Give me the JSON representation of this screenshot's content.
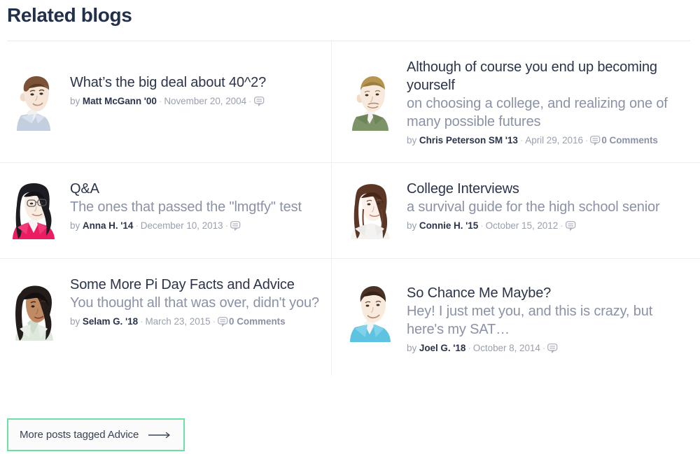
{
  "header": {
    "title": "Related blogs"
  },
  "posts": [
    {
      "title": "What’s the big deal about 40^2?",
      "subtitle": "",
      "by_label": "by",
      "author": "Matt McGann '00",
      "date": "November 20, 2004",
      "comment_icon": "comment-bubble-icon",
      "comments": "",
      "avatar": "avatar-matt-mcgann"
    },
    {
      "title": "Although of course you end up becoming yourself",
      "subtitle": "on choosing a college, and realizing one of many possible futures",
      "by_label": "by",
      "author": "Chris Peterson SM '13",
      "date": "April 29, 2016",
      "comment_icon": "comment-bubble-icon",
      "comments": "0 Comments",
      "avatar": "avatar-chris-peterson"
    },
    {
      "title": "Q&A",
      "subtitle": "The ones that passed the \"lmgtfy\" test",
      "by_label": "by",
      "author": "Anna H. '14",
      "date": "December 10, 2013",
      "comment_icon": "comment-bubble-icon",
      "comments": "",
      "avatar": "avatar-anna-h"
    },
    {
      "title": "College Interviews",
      "subtitle": "a survival guide for the high school senior",
      "by_label": "by",
      "author": "Connie H. '15",
      "date": "October 15, 2012",
      "comment_icon": "comment-bubble-icon",
      "comments": "",
      "avatar": "avatar-connie-h"
    },
    {
      "title": "Some More Pi Day Facts and Advice",
      "subtitle": "You thought all that was over, didn't you?",
      "by_label": "by",
      "author": "Selam G. '18",
      "date": "March 23, 2015",
      "comment_icon": "comment-bubble-icon",
      "comments": "0 Comments",
      "avatar": "avatar-selam-g"
    },
    {
      "title": "So Chance Me Maybe?",
      "subtitle": "Hey! I just met you, and this is crazy, but here's my SAT…",
      "by_label": "by",
      "author": "Joel G. '18",
      "date": "October 8, 2014",
      "comment_icon": "comment-bubble-icon",
      "comments": "",
      "avatar": "avatar-joel-g"
    }
  ],
  "footer": {
    "more_label": "More posts tagged Advice",
    "arrow_icon": "long-arrow-right-icon"
  },
  "colors": {
    "title_text": "#23304a",
    "body_text": "#2b3448",
    "muted_text": "#8b92a5",
    "meta_text": "#9aa0ae",
    "divider": "#eceef1",
    "button_border": "#6ce0a0",
    "button_bg": "#fbfbfc",
    "page_bg": "#ffffff"
  },
  "separator": "·"
}
